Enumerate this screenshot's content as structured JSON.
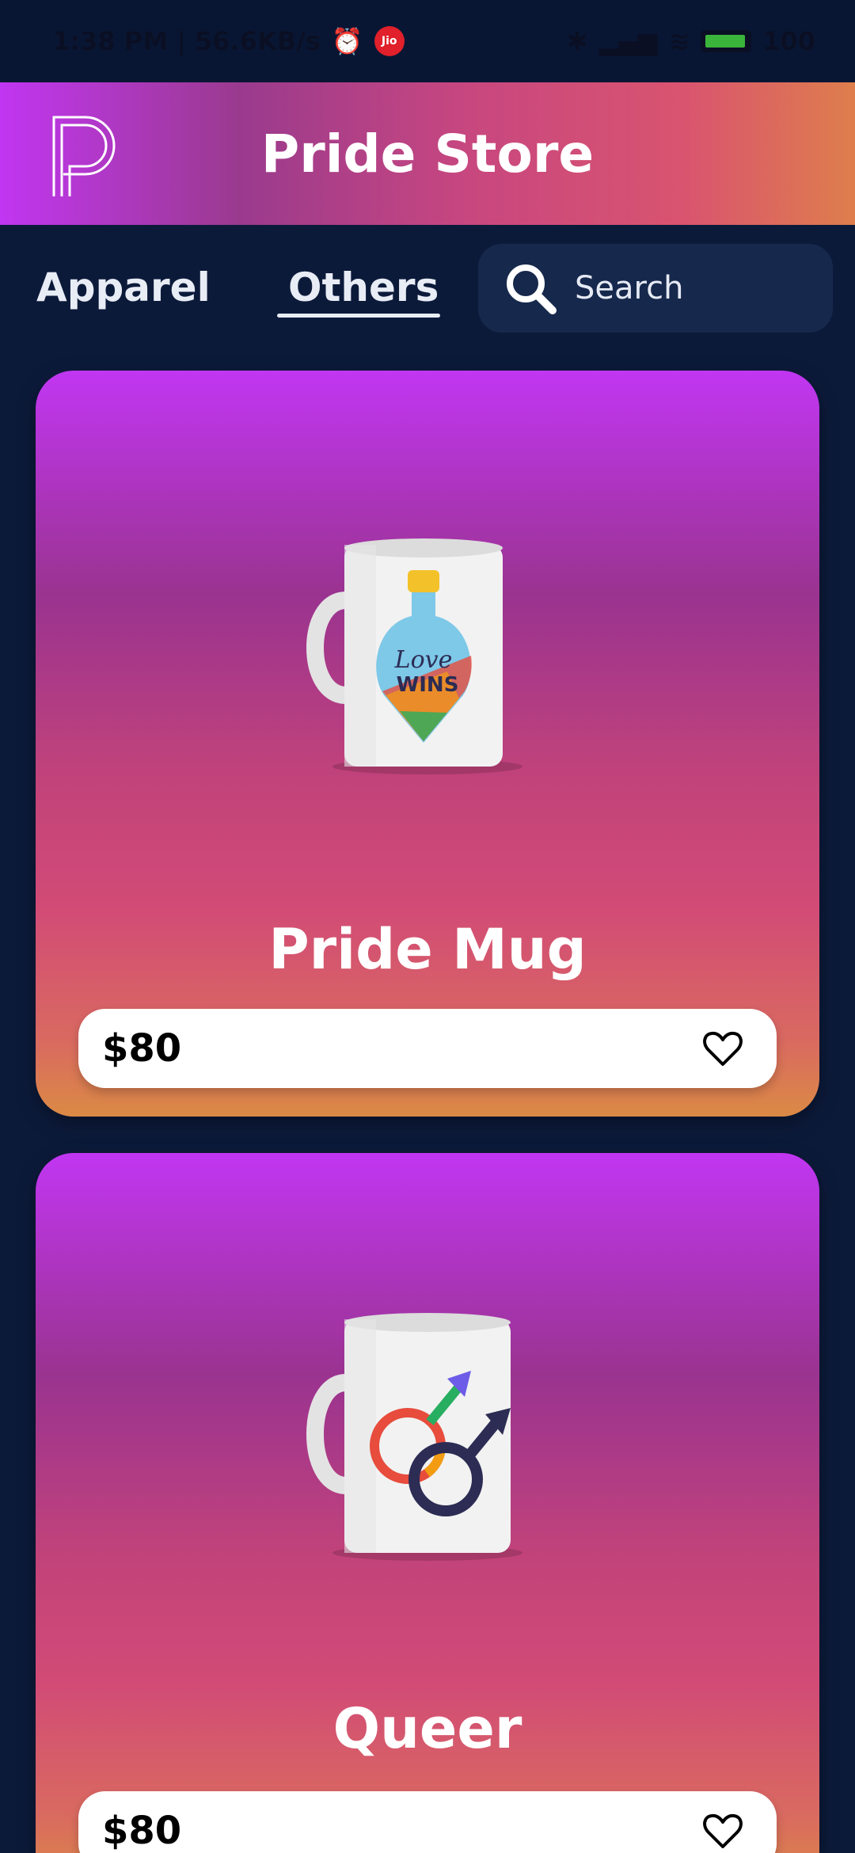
{
  "status_bar": {
    "time_speed": "1:38 PM | 56.6KB/s",
    "carrier_badge": "Jio",
    "battery": "100"
  },
  "header": {
    "title": "Pride Store",
    "logo_icon": "p-logo-icon"
  },
  "tabs": [
    {
      "label": "Apparel",
      "active": false
    },
    {
      "label": "Others",
      "active": true
    }
  ],
  "search": {
    "placeholder": "Search",
    "icon": "search-icon"
  },
  "products": [
    {
      "name": "Pride Mug",
      "price": "$80",
      "image": "mug-love-wins-image",
      "favorite_icon": "heart-outline-icon"
    },
    {
      "name": "Queer",
      "price": "$80",
      "image": "mug-male-symbols-image",
      "favorite_icon": "heart-outline-icon"
    }
  ],
  "colors": {
    "background": "#0c1a3a",
    "search_bg": "#16284c",
    "gradient_top": "#c136f2",
    "gradient_bottom": "#db8a45"
  }
}
